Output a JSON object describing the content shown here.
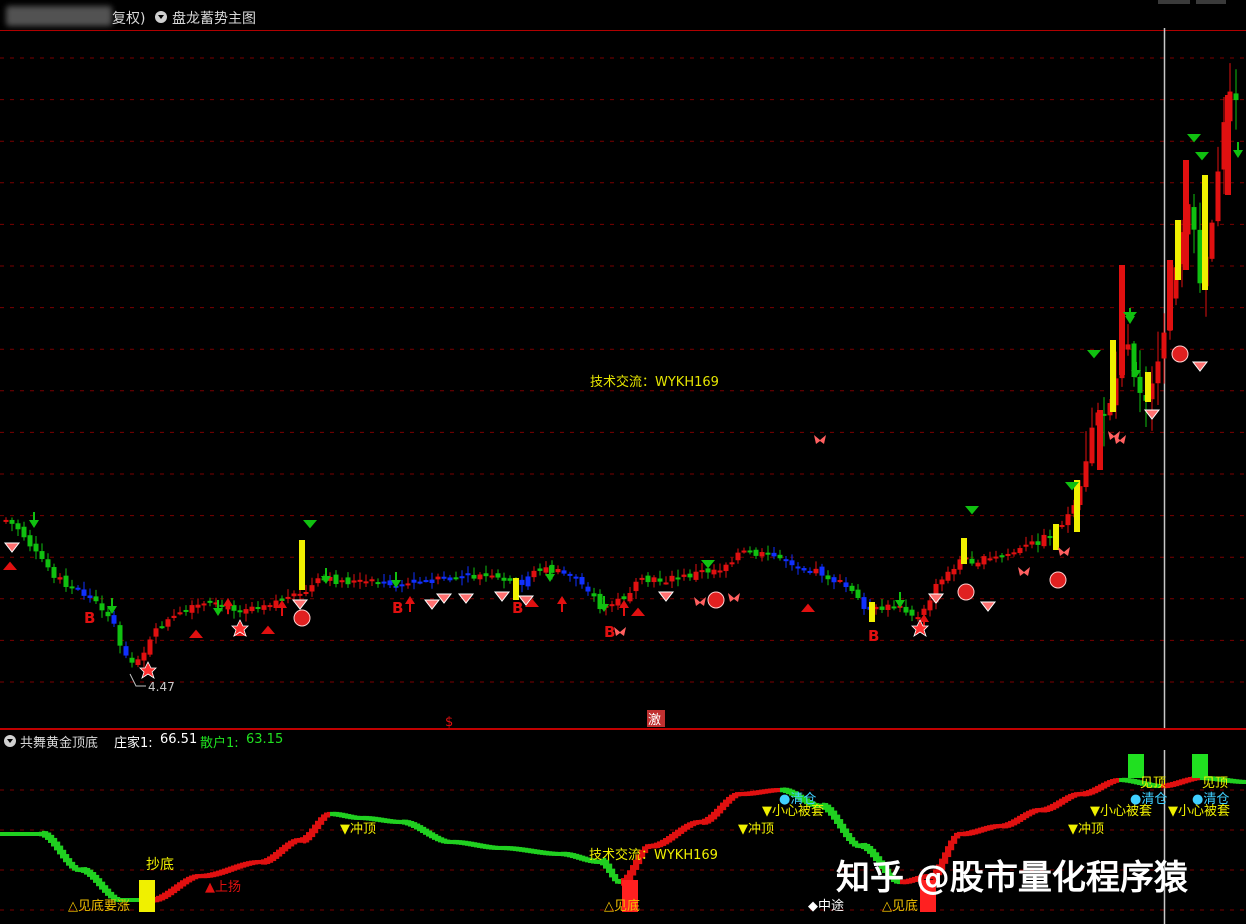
{
  "title_bar": {
    "blurred_stock_name": "",
    "fuquan_suffix": "复权)",
    "indicator_name": "盘龙蓄势主图"
  },
  "main_chart": {
    "watermark": "技术交流：WYKH169",
    "low_price_label": "4.47",
    "bottom_markers": {
      "left": "$",
      "right": "激"
    },
    "buy_label": "B"
  },
  "sub_panel": {
    "indicator_name": "共舞黄金顶底",
    "zhuangjia_label": "庄家1:",
    "zhuangjia_value": "66.51",
    "sanhu_label": "散户1:",
    "sanhu_value": "63.15",
    "watermark": "技术交流：WYKH169",
    "annotations": {
      "chaodi": "抄底",
      "jiandi_yaozhang": "△见底要涨",
      "shangyang": "▲上扬",
      "chongding1": "▼冲顶",
      "jiandi1": "△见底",
      "chongding2": "▼冲顶",
      "xiaoxin1": "▼小心被套",
      "qingcang1": "●清仓",
      "zhongtu": "◆中途",
      "jiandi2": "△见底",
      "chongding3": "▼冲顶",
      "xiaoxin2": "▼小心被套",
      "xiaoxin3": "▼小心被套",
      "qingcang2": "●清仓",
      "qingcang3": "●清仓",
      "jianding1": "见顶",
      "jianding2": "见顶"
    }
  },
  "overlay_watermark": "知乎 @股市量化程序猿",
  "colors": {
    "up": "#e01010",
    "down": "#10c010",
    "blue": "#1030ff",
    "yellow": "#f0f000",
    "grid": "#7a0000",
    "border": "#b00000"
  }
}
